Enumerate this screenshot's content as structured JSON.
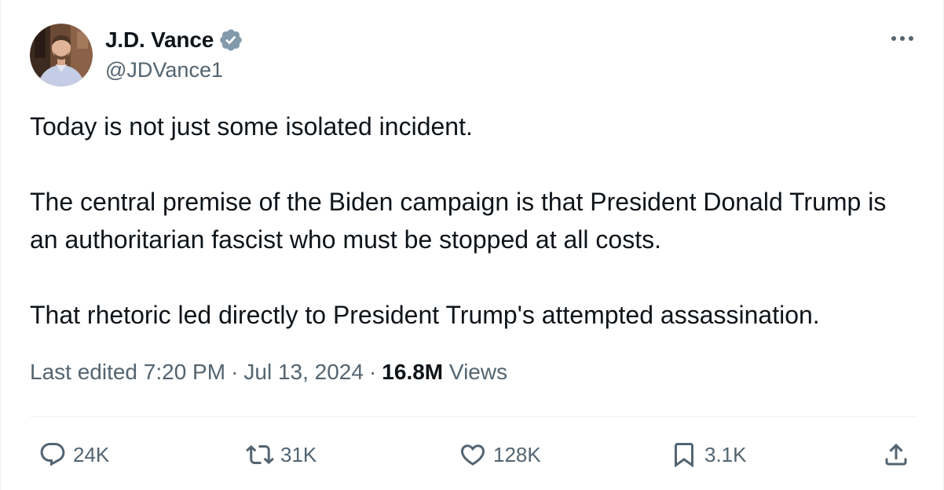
{
  "author": {
    "display_name": "J.D. Vance",
    "handle": "@JDVance1",
    "verified": true,
    "verified_color": "#829aab"
  },
  "tweet": {
    "paragraphs": [
      "Today is not just some isolated incident.",
      "The central premise of the Biden campaign is that President Donald Trump is an authoritarian fascist who must be stopped at all costs.",
      "That rhetoric led directly to President Trump's attempted assassination."
    ]
  },
  "meta": {
    "edited_label": "Last edited",
    "time": "7:20 PM",
    "date": "Jul 13, 2024",
    "views_count": "16.8M",
    "views_label": "Views",
    "separator": "·"
  },
  "actions": {
    "replies": "24K",
    "reposts": "31K",
    "likes": "128K",
    "bookmarks": "3.1K"
  },
  "icons": {
    "more": "more-horizontal-icon",
    "reply": "reply-icon",
    "repost": "repost-icon",
    "like": "heart-icon",
    "bookmark": "bookmark-icon",
    "share": "share-icon"
  },
  "colors": {
    "text_primary": "#0f1419",
    "text_secondary": "#536471",
    "divider": "#eff3f4"
  }
}
